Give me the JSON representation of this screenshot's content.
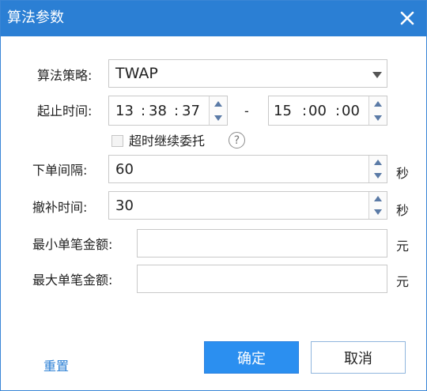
{
  "window": {
    "title": "算法参数"
  },
  "form": {
    "algorithm": {
      "label": "算法策略:",
      "value": "TWAP"
    },
    "time_range": {
      "label": "起止时间:",
      "start": {
        "h": "13",
        "m": "38",
        "s": "37"
      },
      "separator": "-",
      "end": {
        "h": "15",
        "m": "00",
        "s": "00"
      },
      "colon": ":"
    },
    "overtime": {
      "label": "超时继续委托",
      "checked": false,
      "help": "?"
    },
    "order_interval": {
      "label": "下单间隔:",
      "value": "60",
      "unit": "秒"
    },
    "cancel_time": {
      "label": "撤补时间:",
      "value": "30",
      "unit": "秒"
    },
    "min_amount": {
      "label": "最小单笔金额:",
      "value": "",
      "unit": "元"
    },
    "max_amount": {
      "label": "最大单笔金额:",
      "value": "",
      "unit": "元"
    }
  },
  "footer": {
    "reset_label": "重置",
    "ok_label": "确定",
    "cancel_label": "取消"
  },
  "colors": {
    "accent": "#2b7fd4",
    "primary_button": "#2b8ff0"
  }
}
